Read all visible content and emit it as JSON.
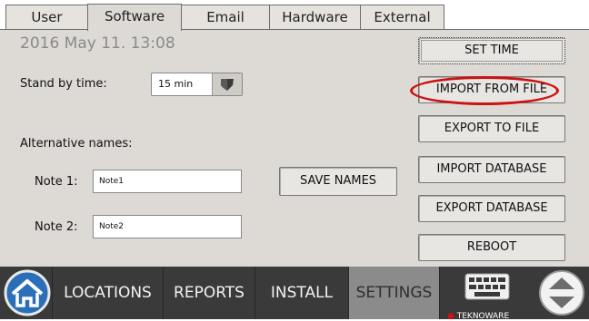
{
  "tabs": [
    {
      "label": "User"
    },
    {
      "label": "Software",
      "active": true
    },
    {
      "label": "Email"
    },
    {
      "label": "Hardware"
    },
    {
      "label": "External"
    }
  ],
  "settings": {
    "datetime": "2016 May 11. 13:08",
    "standby_label": "Stand by time:",
    "standby_value": "15 min",
    "alt_names_label": "Alternative names:",
    "note1_label": "Note 1:",
    "note1_value": "Note1",
    "note2_label": "Note 2:",
    "note2_value": "Note2",
    "save_names": "SAVE NAMES"
  },
  "actions": {
    "set_time": "SET TIME",
    "import_file": "IMPORT FROM FILE",
    "export_file": "EXPORT TO FILE",
    "import_db": "IMPORT DATABASE",
    "export_db": "EXPORT DATABASE",
    "reboot": "REBOOT"
  },
  "highlight_color": "#cc1111",
  "bottom_nav": {
    "locations": "LOCATIONS",
    "reports": "REPORTS",
    "install": "INSTALL",
    "settings": "SETTINGS",
    "brand": "TEKNOWARE",
    "icons": [
      "home-icon",
      "keyboard-icon",
      "scroll-updown-icon"
    ]
  }
}
